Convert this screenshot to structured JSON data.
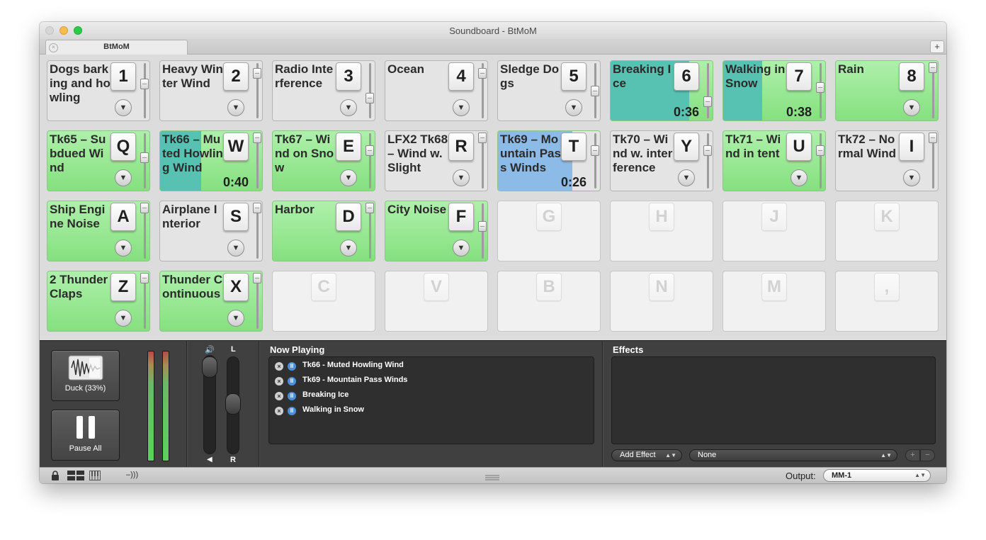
{
  "window": {
    "title": "Soundboard - BtMoM"
  },
  "tabs": {
    "active_label": "BtMoM",
    "close_glyph": "×",
    "add_glyph": "+"
  },
  "pads": [
    {
      "name": "Dogs barking and howling",
      "key": "1",
      "state": "green-off"
    },
    {
      "name": "Heavy Winter Wind",
      "key": "2",
      "state": "grey"
    },
    {
      "name": "Radio Interference",
      "key": "3",
      "state": "grey"
    },
    {
      "name": "Ocean",
      "key": "4",
      "state": "grey"
    },
    {
      "name": "Sledge Dogs",
      "key": "5",
      "state": "grey"
    },
    {
      "name": "Breaking Ice",
      "key": "6",
      "state": "playing",
      "time": "0:36",
      "progress": 0.77,
      "color": "#57c2b2"
    },
    {
      "name": "Walking in Snow",
      "key": "7",
      "state": "playing",
      "time": "0:38",
      "progress": 0.38,
      "color": "#57c2b2"
    },
    {
      "name": "Rain",
      "key": "8",
      "state": "green"
    },
    {
      "name": "Tk65 – Subdued Wind",
      "key": "Q",
      "state": "green"
    },
    {
      "name": "Tk66 – Muted Howling Wind",
      "key": "W",
      "state": "playing",
      "time": "0:40",
      "progress": 0.4,
      "color": "#57c2b2"
    },
    {
      "name": "Tk67 – Wind on Snow",
      "key": "E",
      "state": "green"
    },
    {
      "name": "LFX2 Tk68 – Wind w. Slight",
      "key": "R",
      "state": "grey"
    },
    {
      "name": "Tk69 – Mountain Pass Winds",
      "key": "T",
      "state": "playing",
      "time": "0:26",
      "progress": 0.73,
      "color": "#8dbbe8"
    },
    {
      "name": "Tk70 – Wind w. interference",
      "key": "Y",
      "state": "grey"
    },
    {
      "name": "Tk71 – Wind in tent",
      "key": "U",
      "state": "green"
    },
    {
      "name": "Tk72 – Normal Wind",
      "key": "I",
      "state": "grey"
    },
    {
      "name": "Ship Engine Noise",
      "key": "A",
      "state": "green"
    },
    {
      "name": "Airplane Interior",
      "key": "S",
      "state": "grey"
    },
    {
      "name": "Harbor",
      "key": "D",
      "state": "green"
    },
    {
      "name": "City Noise",
      "key": "F",
      "state": "green"
    },
    {
      "name": "",
      "key": "G",
      "state": "empty"
    },
    {
      "name": "",
      "key": "H",
      "state": "empty"
    },
    {
      "name": "",
      "key": "J",
      "state": "empty"
    },
    {
      "name": "",
      "key": "K",
      "state": "empty"
    },
    {
      "name": "2 Thunder Claps",
      "key": "Z",
      "state": "green"
    },
    {
      "name": "Thunder Continuous",
      "key": "X",
      "state": "green"
    },
    {
      "name": "",
      "key": "C",
      "state": "empty"
    },
    {
      "name": "",
      "key": "V",
      "state": "empty"
    },
    {
      "name": "",
      "key": "B",
      "state": "empty"
    },
    {
      "name": "",
      "key": "N",
      "state": "empty"
    },
    {
      "name": "",
      "key": "M",
      "state": "empty"
    },
    {
      "name": "",
      "key": ",",
      "state": "empty"
    }
  ],
  "controls": {
    "duck_label": "Duck (33%)",
    "pause_label": "Pause All",
    "balance_left": "L",
    "balance_right": "R",
    "volume_icon": "speaker-icon"
  },
  "now_playing": {
    "title": "Now Playing",
    "items": [
      "Tk66 - Muted Howling Wind",
      "Tk69 - Mountain Pass Winds",
      "Breaking Ice",
      "Walking in Snow"
    ]
  },
  "effects": {
    "title": "Effects",
    "add_effect_label": "Add Effect",
    "preset_value": "None",
    "plus": "+",
    "minus": "−"
  },
  "statusbar": {
    "output_label": "Output:",
    "output_value": "MM-1"
  },
  "colors": {
    "pad_green": "#8ee48a",
    "pad_grey": "#e4e4e4",
    "playing_teal": "#57c2b2",
    "playing_blue": "#8dbbe8",
    "panel_dark": "#404040"
  }
}
